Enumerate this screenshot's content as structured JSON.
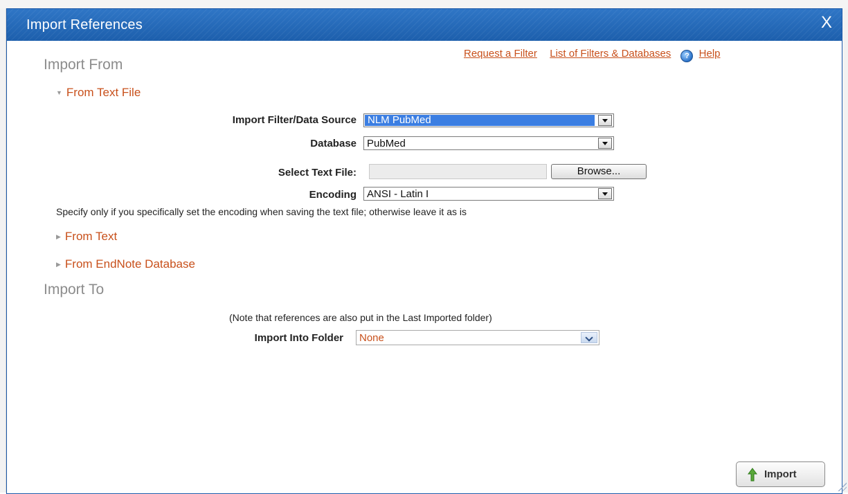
{
  "dialog": {
    "title": "Import References",
    "close_label": "X"
  },
  "import_from": {
    "heading": "Import From",
    "links": {
      "request_filter": "Request a Filter",
      "filters_databases": "List of Filters & Databases",
      "help": "Help"
    },
    "from_text_file": {
      "label": "From Text File",
      "expanded": true,
      "filter_label": "Import Filter/Data Source",
      "filter_value": "NLM PubMed",
      "database_label": "Database",
      "database_value": "PubMed",
      "file_label": "Select Text File:",
      "file_value": "",
      "browse_label": "Browse...",
      "encoding_label": "Encoding",
      "encoding_value": "ANSI - Latin I",
      "encoding_hint": "Specify only if you specifically set the encoding when saving the text file; otherwise leave it as is"
    },
    "from_text": {
      "label": "From Text",
      "expanded": false
    },
    "from_endnote": {
      "label": "From EndNote Database",
      "expanded": false
    }
  },
  "import_to": {
    "heading": "Import To",
    "note": "(Note that references are also put in the Last Imported folder)",
    "folder_label": "Import Into Folder",
    "folder_value": "None"
  },
  "actions": {
    "import_label": "Import"
  },
  "colors": {
    "titlebar": "#1d5fac",
    "link": "#c8501b",
    "selection": "#3b7ee2",
    "heading_gray": "#8c8c8c"
  }
}
